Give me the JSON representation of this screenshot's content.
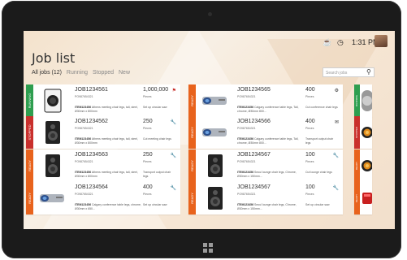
{
  "app": {
    "title": "Job list",
    "clock": "1:31 PM",
    "filters": [
      {
        "label": "All jobs (12)",
        "active": true
      },
      {
        "label": "Running",
        "active": false
      },
      {
        "label": "Stopped",
        "active": false
      },
      {
        "label": "New",
        "active": false
      }
    ],
    "search_placeholder": "Search jobs"
  },
  "icons": {
    "coffee": "coffee-cup-icon",
    "clock": "clock-icon",
    "search": "magnifier-icon",
    "flag": "flag-icon",
    "wrench": "wrench-icon",
    "gear": "gear-icon",
    "message": "message-icon"
  },
  "status_colors": {
    "RUNNING": "#2e9e4f",
    "STOPPED": "#c9302c",
    "READY": "#e8631d"
  },
  "jobs": [
    {
      "job": "JOB1234561",
      "po": "PO987654321",
      "item_code": "ITEM123456",
      "item_desc": "Athens meeting chair legs, tall, steel, Ø30mm x 800mm",
      "qty": "1,000,000",
      "unit": "Pieces",
      "step": "Set up circular saw",
      "status": "RUNNING",
      "product": "speaker-white",
      "action": "flag-icon"
    },
    {
      "job": "JOB1234562",
      "po": "PO987654321",
      "item_code": "ITEM123456",
      "item_desc": "Athens meeting chair legs, tall, steel, Ø30mm x 800mm",
      "qty": "250",
      "unit": "Pieces",
      "step": "Cut meeting chair legs",
      "status": "STOPPED",
      "product": "speaker-black",
      "action": "wrench-icon"
    },
    {
      "job": "JOB1234563",
      "po": "PO987654321",
      "item_code": "ITEM123456",
      "item_desc": "Athens meeting chair legs, tall, steel, Ø30mm x 800mm",
      "qty": "250",
      "unit": "Pieces",
      "step": "Transport output chair legs",
      "status": "READY",
      "product": "speaker-black",
      "action": "wrench-icon"
    },
    {
      "job": "JOB1234564",
      "po": "PO987654321",
      "item_code": "ITEM123456",
      "item_desc": "Calgary conference table legs, chrome, Ø30mm x 650...",
      "qty": "400",
      "unit": "Pieces",
      "step": "Set up circular saw",
      "status": "READY",
      "product": "projector",
      "action": "wrench-icon"
    },
    {
      "job": "JOB1234565",
      "po": "PO987654321",
      "item_code": "ITEM123456",
      "item_desc": "Calgary conference table legs, Tall, chrome, Ø30mm 800...",
      "qty": "400",
      "unit": "Pieces",
      "step": "Cut conference chair legs",
      "status": "READY",
      "product": "projector",
      "action": "gear-icon"
    },
    {
      "job": "JOB1234566",
      "po": "PO987654321",
      "item_code": "ITEM123456",
      "item_desc": "Calgary conference table legs, Tall, chrome, Ø30mm 800...",
      "qty": "400",
      "unit": "Pieces",
      "step": "Transport output chair legs",
      "status": "READY",
      "product": "projector",
      "action": "message-icon"
    },
    {
      "job": "JOB1234567",
      "po": "PO987654321",
      "item_code": "ITEM123456",
      "item_desc": "Seoul lounge chair legs, Chrome, Ø30mm x 150mm...",
      "qty": "100",
      "unit": "Pieces",
      "step": "Cut lounge chair legs",
      "status": "READY",
      "product": "speaker-black",
      "action": "wrench-icon"
    },
    {
      "job": "JOB1234567",
      "po": "PO987654321",
      "item_code": "ITEM123456",
      "item_desc": "Seoul lounge chair legs, Chrome, Ø30mm x 150mm...",
      "qty": "100",
      "unit": "Pieces",
      "step": "Set up circular saw",
      "status": "READY",
      "product": "speaker-black",
      "action": "wrench-icon"
    }
  ],
  "side_tiles": [
    {
      "status": "RUNNING",
      "product": "speaker-gray"
    },
    {
      "status": "STOPPED",
      "product": "speaker-orange"
    },
    {
      "status": "READY",
      "product": "speaker-orange"
    },
    {
      "status": "READY",
      "product": "speaker-red"
    }
  ]
}
